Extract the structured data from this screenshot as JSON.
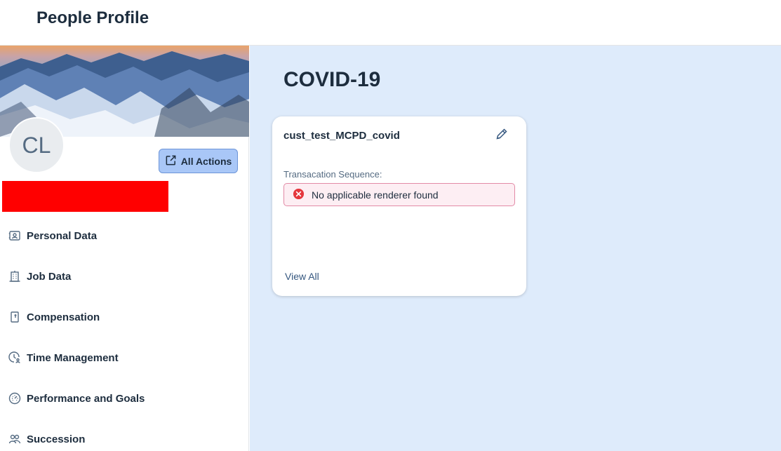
{
  "header": {
    "title": "People Profile"
  },
  "profile": {
    "initials": "CL",
    "all_actions_label": "All Actions"
  },
  "nav": {
    "items": [
      {
        "label": "Personal Data",
        "icon": "personal-data-icon"
      },
      {
        "label": "Job Data",
        "icon": "building-icon"
      },
      {
        "label": "Compensation",
        "icon": "compensation-icon"
      },
      {
        "label": "Time Management",
        "icon": "time-management-icon"
      },
      {
        "label": "Performance and Goals",
        "icon": "performance-icon"
      },
      {
        "label": "Succession",
        "icon": "succession-icon"
      }
    ]
  },
  "main": {
    "section_title": "COVID-19",
    "card": {
      "title": "cust_test_MCPD_covid",
      "field_label": "Transacation Sequence:",
      "error_message": "No applicable renderer found",
      "view_all_label": "View All"
    }
  },
  "colors": {
    "accent_button": "#a9c7f7",
    "main_background": "#deebfb",
    "error_icon": "#e5373d",
    "error_background": "#fdeef3",
    "redaction": "#ff0000"
  }
}
